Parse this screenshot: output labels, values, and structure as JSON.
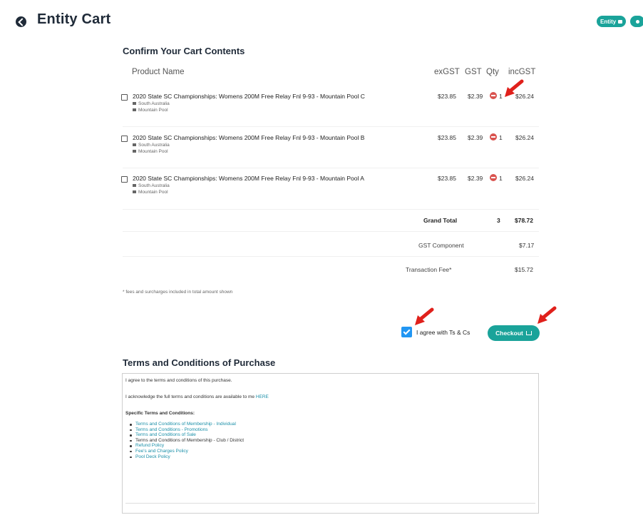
{
  "header": {
    "title": "Entity Cart",
    "entity_label": "Entity"
  },
  "cart": {
    "heading": "Confirm Your Cart Contents",
    "columns": {
      "product": "Product Name",
      "exgst": "exGST",
      "gst": "GST",
      "qty": "Qty",
      "incgst": "incGST"
    },
    "items": [
      {
        "name": "2020 State SC Championships: Womens 200M Free Relay Fnl 9-93 - Mountain Pool C",
        "region": "South Australia",
        "club": "Mountain Pool",
        "exgst": "$23.85",
        "gst": "$2.39",
        "qty": "1",
        "incgst": "$26.24"
      },
      {
        "name": "2020 State SC Championships: Womens 200M Free Relay Fnl 9-93 - Mountain Pool B",
        "region": "South Australia",
        "club": "Mountain Pool",
        "exgst": "$23.85",
        "gst": "$2.39",
        "qty": "1",
        "incgst": "$26.24"
      },
      {
        "name": "2020 State SC Championships: Womens 200M Free Relay Fnl 9-93 - Mountain Pool A",
        "region": "South Australia",
        "club": "Mountain Pool",
        "exgst": "$23.85",
        "gst": "$2.39",
        "qty": "1",
        "incgst": "$26.24"
      }
    ],
    "summary": {
      "grand_total_label": "Grand Total",
      "grand_total_qty": "3",
      "grand_total": "$78.72",
      "gst_label": "GST Component",
      "gst": "$7.17",
      "fee_label": "Transaction Fee*",
      "fee": "$15.72"
    },
    "footnote": "* fees and surcharges included in total amount shown"
  },
  "checkout": {
    "agree_label": "I agree with Ts & Cs",
    "agree_checked": true,
    "button_label": "Checkout"
  },
  "terms": {
    "heading": "Terms and Conditions of Purchase",
    "line1": "I agree to the terms and conditions of this purchase.",
    "line2_text": "I acknowledge the full terms and conditions are available to me ",
    "line2_link": "HERE",
    "specific_heading": "Specific Terms and Conditions:",
    "items": [
      {
        "label": "Terms and Conditions of Membership - Individual",
        "link": true
      },
      {
        "label": "Terms and Conditions - Promotions",
        "link": true
      },
      {
        "label": "Terms and Conditions of Sale",
        "link": true
      },
      {
        "label": "Terms and Conditions of Membership - Club / District",
        "link": false
      },
      {
        "label": "Refund Policy",
        "link": true
      },
      {
        "label": "Fee's and Charges Policy",
        "link": true
      },
      {
        "label": "Pool Deck Policy",
        "link": true
      }
    ]
  },
  "colors": {
    "teal": "#1aa39a",
    "checkbox_blue": "#2196f3",
    "minus_red": "#d9534f",
    "arrow_red": "#e0201b",
    "link": "#1a8fa8"
  }
}
